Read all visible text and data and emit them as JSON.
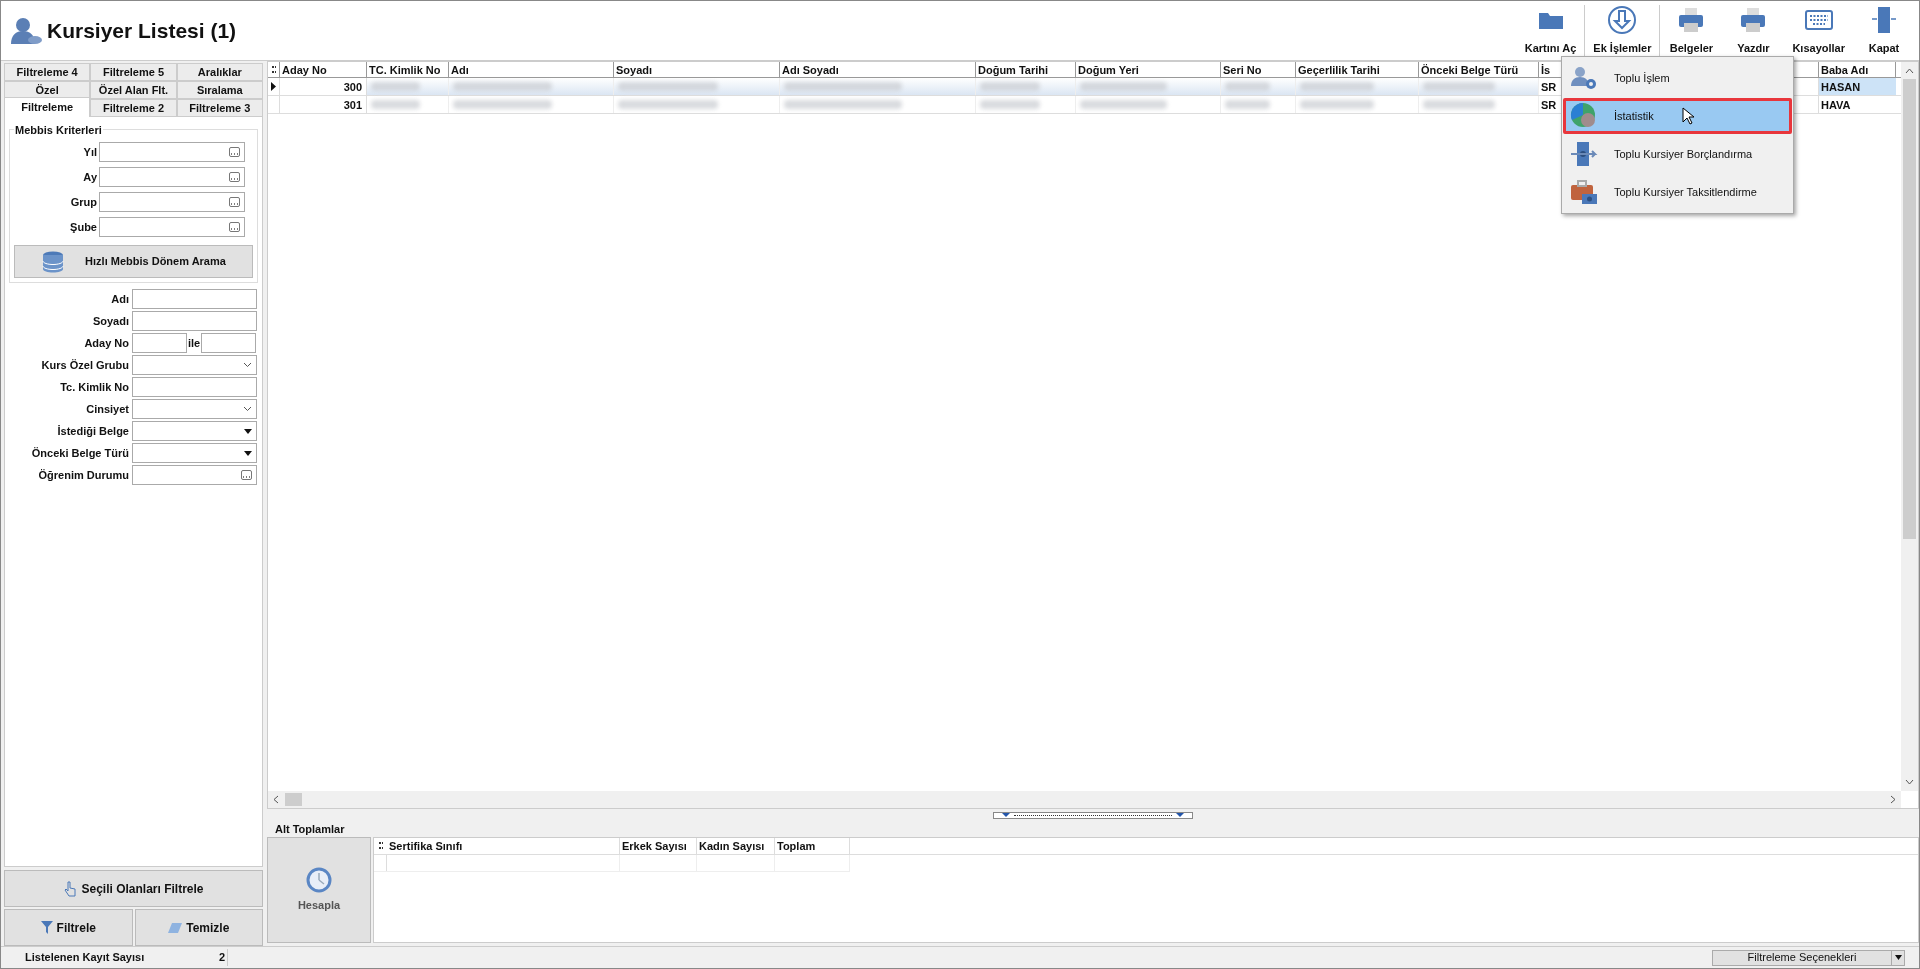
{
  "window": {
    "title": "Kursiyer Listesi (1)"
  },
  "toolbar": [
    {
      "label": "Kartını Aç",
      "kind": "folder"
    },
    {
      "label": "Ek İşlemler",
      "kind": "download"
    },
    {
      "label": "Belgeler",
      "kind": "printer"
    },
    {
      "label": "Yazdır",
      "kind": "printer"
    },
    {
      "label": "Kısayollar",
      "kind": "keyboard"
    },
    {
      "label": "Kapat",
      "kind": "door"
    }
  ],
  "filter_tabs": [
    [
      {
        "label": "Filtreleme 4",
        "selected": false
      },
      {
        "label": "Filtreleme 5",
        "selected": false
      },
      {
        "label": "Aralıklar",
        "selected": false
      }
    ],
    [
      {
        "label": "Özel",
        "selected": false
      },
      {
        "label": "Özel Alan Flt.",
        "selected": false
      },
      {
        "label": "Sıralama",
        "selected": false
      }
    ],
    [
      {
        "label": "Filtreleme",
        "selected": true
      },
      {
        "label": "Filtreleme 2",
        "selected": false
      },
      {
        "label": "Filtreleme 3",
        "selected": false
      }
    ]
  ],
  "mebbis": {
    "title": "Mebbis Kriterleri",
    "fields": [
      {
        "label": "Yıl"
      },
      {
        "label": "Ay"
      },
      {
        "label": "Grup"
      },
      {
        "label": "Şube"
      }
    ],
    "button": "Hızlı Mebbis Dönem Arama"
  },
  "fields": [
    {
      "label": "Adı",
      "kind": "text"
    },
    {
      "label": "Soyadı",
      "kind": "text"
    },
    {
      "label": "Aday No",
      "kind": "range",
      "between": "ile"
    },
    {
      "label": "Kurs Özel Grubu",
      "kind": "combo"
    },
    {
      "label": "Tc. Kimlik No",
      "kind": "text"
    },
    {
      "label": "Cinsiyet",
      "kind": "combo"
    },
    {
      "label": "İstediği Belge",
      "kind": "dropdown"
    },
    {
      "label": "Önceki Belge Türü",
      "kind": "dropdown"
    },
    {
      "label": "Öğrenim Durumu",
      "kind": "ellipsis"
    }
  ],
  "buttons": {
    "select": "Seçili Olanları Filtrele",
    "filter": "Filtrele",
    "clear": "Temizle"
  },
  "table": {
    "columns": [
      "Aday No",
      "TC. Kimlik No",
      "Adı",
      "Soyadı",
      "Adı Soyadı",
      "Doğum Tarihi",
      "Doğum Yeri",
      "Seri No",
      "Geçerlilik Tarihi",
      "Önceki Belge Türü",
      "İs",
      "Baba Adı"
    ],
    "rows": [
      {
        "aday_no": "300",
        "column_11": "SR",
        "baba_adi": "HASAN",
        "selected": true
      },
      {
        "aday_no": "301",
        "column_11": "SR",
        "baba_adi": "HAVA",
        "selected": false
      }
    ]
  },
  "menu": [
    {
      "label": "Toplu İşlem",
      "kind": "users",
      "selected": false
    },
    {
      "label": "İstatistik",
      "kind": "chart",
      "selected": true
    },
    {
      "label": "Toplu Kursiyer Borçlandırma",
      "kind": "money",
      "selected": false
    },
    {
      "label": "Toplu Kursiyer Taksitlendirme",
      "kind": "case",
      "selected": false
    }
  ],
  "subtotals": {
    "title": "Alt Toplamlar",
    "button": "Hesapla",
    "columns": [
      "Sertifika Sınıfı",
      "Erkek Sayısı",
      "Kadın Sayısı",
      "Toplam"
    ]
  },
  "status_bar": {
    "label": "Listelenen Kayıt Sayısı",
    "value": "2",
    "options": "Filtreleme Seçenekleri"
  }
}
